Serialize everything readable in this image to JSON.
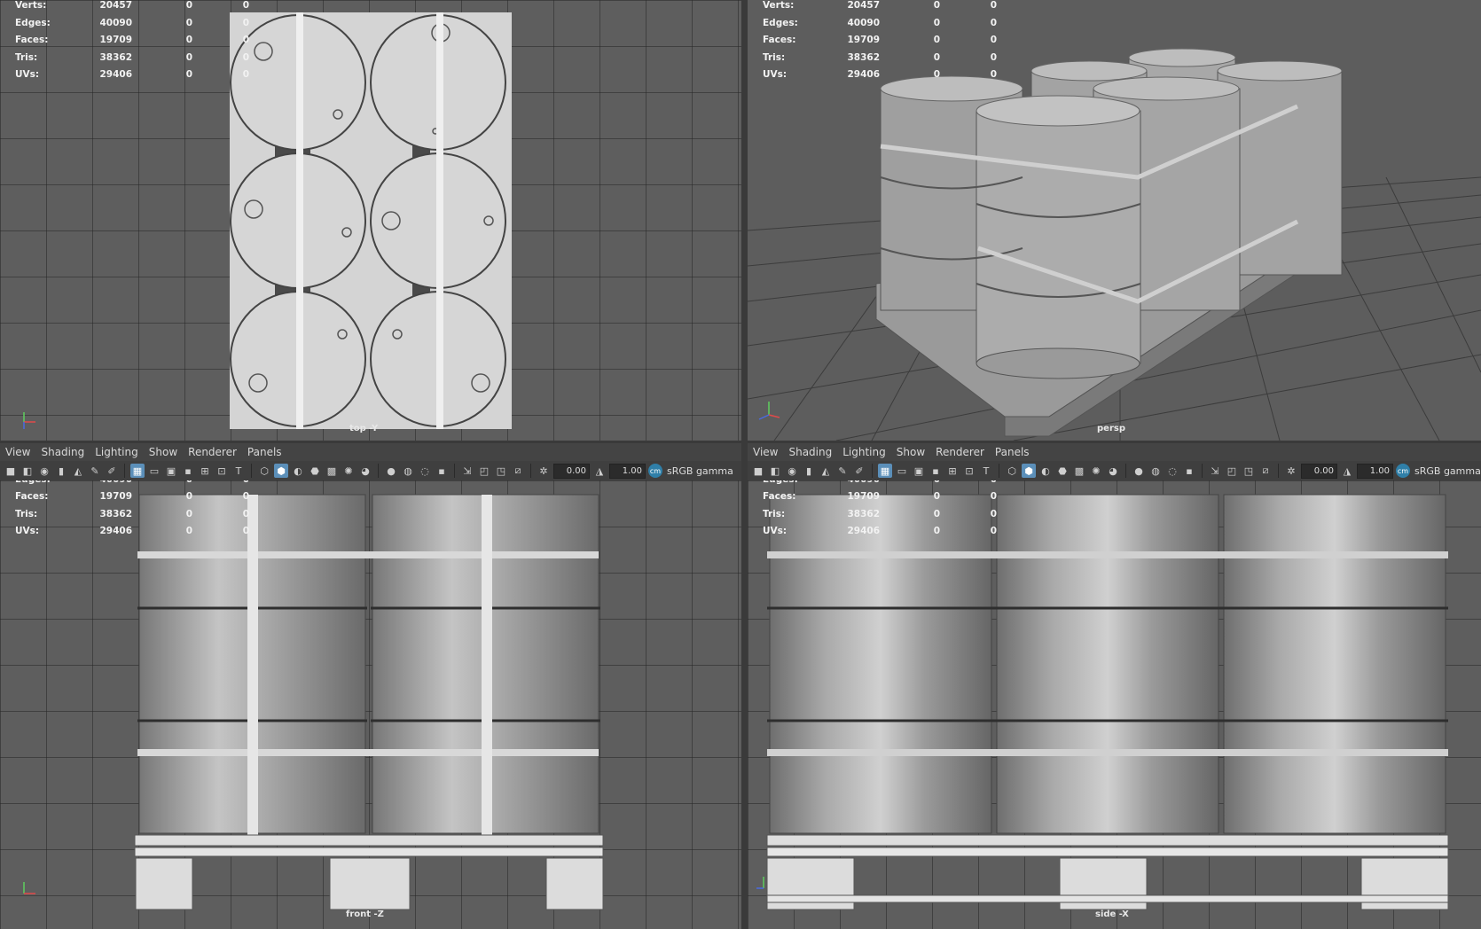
{
  "stats": {
    "labels": [
      "Verts:",
      "Edges:",
      "Faces:",
      "Tris:",
      "UVs:"
    ],
    "values": [
      "20457",
      "40090",
      "19709",
      "38362",
      "29406"
    ],
    "col2": "0",
    "col3": "0"
  },
  "menu": [
    "View",
    "Shading",
    "Lighting",
    "Show",
    "Renderer",
    "Panels"
  ],
  "toolbar": {
    "exposure": "0.00",
    "gamma": "1.00",
    "colorspace": "sRGB gamma"
  },
  "cameras": {
    "top": "top -Y",
    "persp": "persp",
    "front": "front -Z",
    "side": "side -X"
  },
  "axis_labels": {
    "y": "y",
    "x": "x",
    "z": "z"
  },
  "icons": [
    "camera-icon",
    "camera-attributes-icon",
    "bookmark-icon",
    "image-plane-icon",
    "grid-icon",
    "film-gate-icon",
    "resolution-gate-icon",
    "wireframe-icon",
    "smooth-shade-icon",
    "textured-icon",
    "lights-icon",
    "shadows-icon",
    "ambient-occlusion-icon",
    "isolate-icon",
    "xray-icon",
    "exposure-icon",
    "gamma-icon",
    "colorspace-icon"
  ]
}
